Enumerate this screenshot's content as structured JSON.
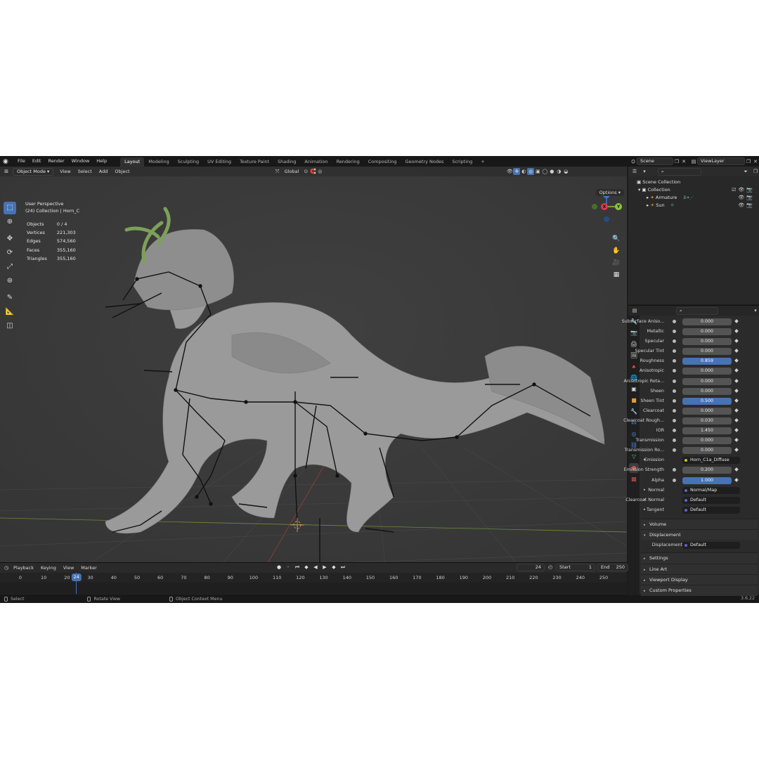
{
  "topbar": {
    "menus": [
      "File",
      "Edit",
      "Render",
      "Window",
      "Help"
    ],
    "workspaces": [
      "Layout",
      "Modeling",
      "Sculpting",
      "UV Editing",
      "Texture Paint",
      "Shading",
      "Animation",
      "Rendering",
      "Compositing",
      "Geometry Nodes",
      "Scripting"
    ],
    "active_workspace": "Layout",
    "add_tab": "+",
    "scene_name": "Scene",
    "view_layer": "ViewLayer"
  },
  "viewport": {
    "mode": "Object Mode",
    "menus": [
      "View",
      "Select",
      "Add",
      "Object"
    ],
    "orientation": "Global",
    "options_label": "Options",
    "perspective": "User Perspective",
    "collection_info": "(24) Collection | Horn_C",
    "stats": [
      {
        "label": "Objects",
        "value": "0 / 4"
      },
      {
        "label": "Vertices",
        "value": "221,303"
      },
      {
        "label": "Edges",
        "value": "574,560"
      },
      {
        "label": "Faces",
        "value": "355,160"
      },
      {
        "label": "Triangles",
        "value": "355,160"
      }
    ],
    "gizmo": {
      "x": "X",
      "y": "Y",
      "z": "Z"
    }
  },
  "timeline": {
    "menus": [
      "Playback",
      "Keying",
      "View",
      "Marker"
    ],
    "current_frame": "24",
    "start_label": "Start",
    "start_value": "1",
    "end_label": "End",
    "end_value": "250",
    "ruler": [
      "0",
      "10",
      "20",
      "30",
      "40",
      "50",
      "60",
      "70",
      "80",
      "90",
      "100",
      "110",
      "120",
      "130",
      "140",
      "150",
      "160",
      "170",
      "180",
      "190",
      "200",
      "210",
      "220",
      "230",
      "240",
      "250"
    ]
  },
  "statusbar": {
    "select": "Select",
    "rotate": "Rotate View",
    "context": "Object Context Menu",
    "version": "3.6.22"
  },
  "outliner": {
    "scene_collection": "Scene Collection",
    "collection": "Collection",
    "items": [
      "Armature",
      "Sun"
    ]
  },
  "properties": {
    "rows": [
      {
        "label": "Subsurface Aniso...",
        "value": "0.000",
        "style": "num"
      },
      {
        "label": "Metallic",
        "value": "0.000",
        "style": "num"
      },
      {
        "label": "Specular",
        "value": "0.000",
        "style": "num"
      },
      {
        "label": "Specular Tint",
        "value": "0.000",
        "style": "num"
      },
      {
        "label": "Roughness",
        "value": "0.859",
        "style": "blue"
      },
      {
        "label": "Anisotropic",
        "value": "0.000",
        "style": "num"
      },
      {
        "label": "Anisotropic Rota...",
        "value": "0.000",
        "style": "num"
      },
      {
        "label": "Sheen",
        "value": "0.000",
        "style": "num"
      },
      {
        "label": "Sheen Tint",
        "value": "0.500",
        "style": "blue"
      },
      {
        "label": "Clearcoat",
        "value": "0.000",
        "style": "num"
      },
      {
        "label": "Clearcoat Rough...",
        "value": "0.030",
        "style": "num"
      },
      {
        "label": "IOR",
        "value": "1.450",
        "style": "num"
      },
      {
        "label": "Transmission",
        "value": "0.000",
        "style": "num"
      },
      {
        "label": "Transmission Ro...",
        "value": "0.000",
        "style": "num"
      },
      {
        "label": "Emission",
        "value": "Horn_C1a_Diffuse",
        "style": "link"
      },
      {
        "label": "Emission Strength",
        "value": "0.200",
        "style": "num"
      },
      {
        "label": "Alpha",
        "value": "1.000",
        "style": "blue"
      },
      {
        "label": "Normal",
        "value": "Normal/Map",
        "style": "link2"
      },
      {
        "label": "Clearcoat Normal",
        "value": "Default",
        "style": "link2"
      },
      {
        "label": "Tangent",
        "value": "Default",
        "style": "link2"
      }
    ],
    "panels_a": [
      "Volume"
    ],
    "displacement_panel": "Displacement",
    "displacement_label": "Displacement",
    "displacement_value": "Default",
    "panels_b": [
      "Settings",
      "Line Art",
      "Viewport Display",
      "Custom Properties"
    ]
  },
  "colors": {
    "accent": "#4772b3",
    "axis_x": "#e0374f",
    "axis_y": "#8bc53f",
    "axis_z": "#3a7be0"
  }
}
